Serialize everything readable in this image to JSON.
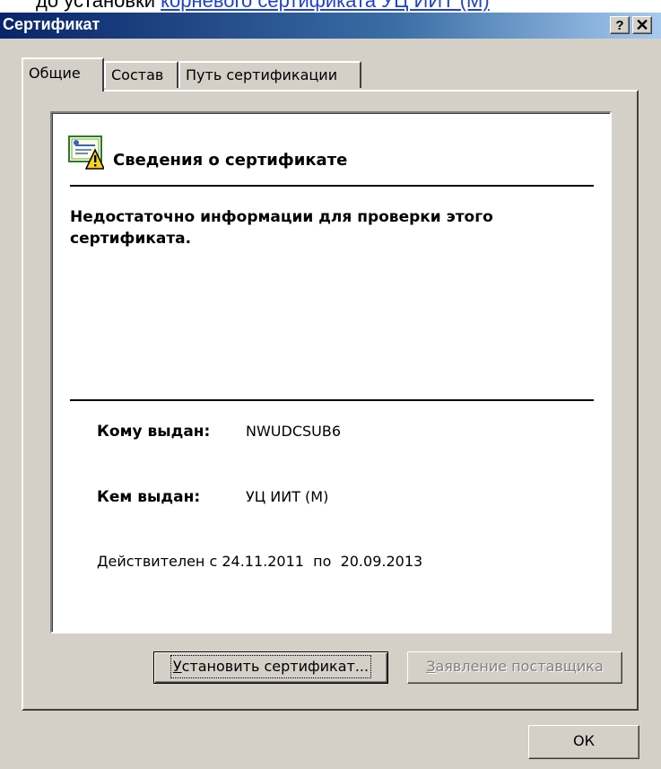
{
  "background": {
    "prefix": "до установки ",
    "link_text": "корневого сертификата УЦ ИИТ (М)"
  },
  "window": {
    "title": "Сертификат",
    "help_label": "?",
    "close_label": "✕"
  },
  "tabs": [
    {
      "label": "Общие",
      "active": true
    },
    {
      "label": "Состав",
      "active": false
    },
    {
      "label": "Путь сертификации",
      "active": false
    }
  ],
  "info": {
    "icon": "certificate-warning-icon",
    "title": "Сведения о сертификате",
    "warning": "Недостаточно информации для проверки этого сертификата.",
    "issued_to_label": "Кому выдан:",
    "issued_to_value": "NWUDCSUB6",
    "issued_by_label": "Кем выдан:",
    "issued_by_value": "УЦ ИИТ (М)",
    "valid_prefix": "Действителен с",
    "valid_from": "24.11.2011",
    "valid_sep": "по",
    "valid_to": "20.09.2013"
  },
  "buttons": {
    "install_first": "У",
    "install_rest": "становить сертификат...",
    "issuer_first": "З",
    "issuer_rest": "аявление поставщика",
    "ok": "ОК"
  },
  "colors": {
    "titlebar_start": "#0a246a",
    "titlebar_end": "#a6caf0",
    "face": "#d4d0c8",
    "link": "#2142c8"
  }
}
